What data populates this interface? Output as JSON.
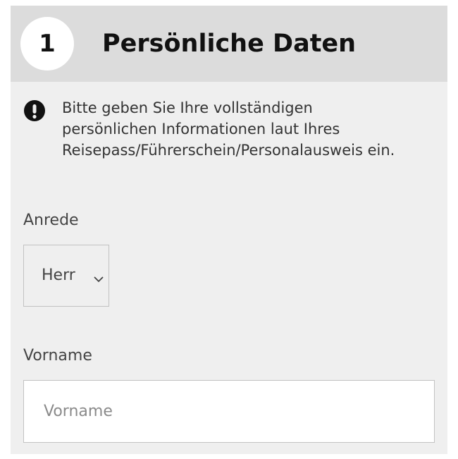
{
  "section": {
    "step_number": "1",
    "title": "Persönliche Daten"
  },
  "notice": {
    "icon": "alert-icon",
    "text": "Bitte geben Sie Ihre vollständigen\npersönlichen Informationen laut Ihres\nReisepass/Führerschein/Personalausweis ein."
  },
  "fields": {
    "salutation": {
      "label": "Anrede",
      "selected": "Herr",
      "icon": "chevron-down-icon"
    },
    "first_name": {
      "label": "Vorname",
      "value": "",
      "placeholder": "Vorname"
    }
  },
  "colors": {
    "header_bg": "#dcdcdc",
    "card_bg": "#efefef",
    "text_dark": "#111111",
    "text_body": "#333333",
    "border": "#c2c2c2"
  }
}
